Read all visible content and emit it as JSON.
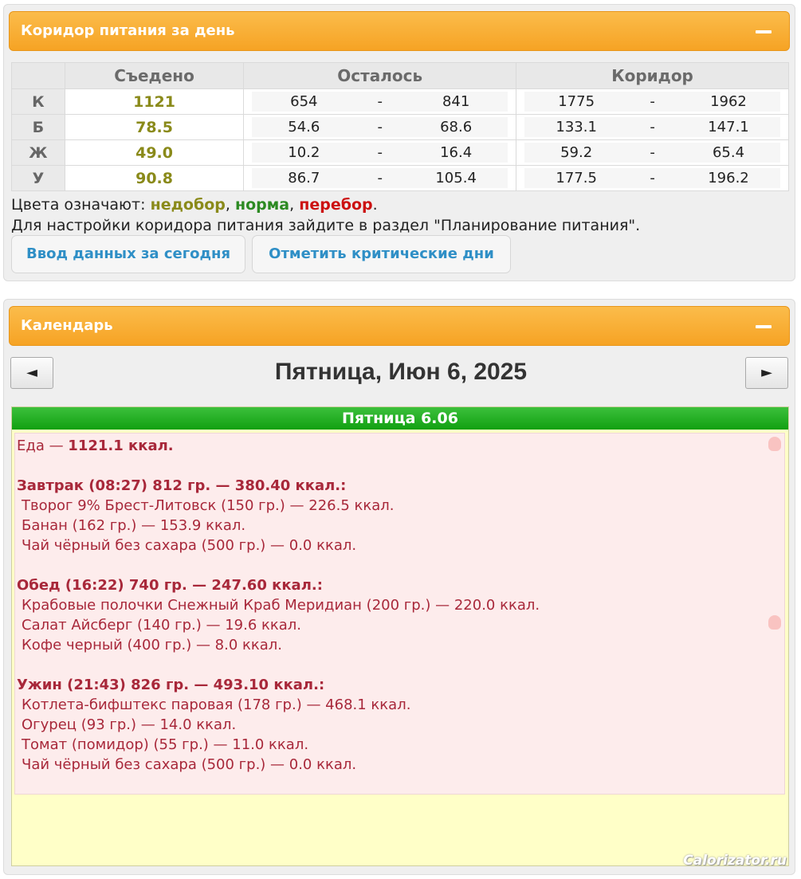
{
  "corridor": {
    "header": "Коридор питания за день",
    "columns": {
      "eaten": "Съедено",
      "remaining": "Осталось",
      "corridor": "Коридор"
    },
    "separator": "-",
    "rows": [
      {
        "label": "К",
        "eaten": "1121",
        "rem_lo": "654",
        "rem_hi": "841",
        "cor_lo": "1775",
        "cor_hi": "1962"
      },
      {
        "label": "Б",
        "eaten": "78.5",
        "rem_lo": "54.6",
        "rem_hi": "68.6",
        "cor_lo": "133.1",
        "cor_hi": "147.1"
      },
      {
        "label": "Ж",
        "eaten": "49.0",
        "rem_lo": "10.2",
        "rem_hi": "16.4",
        "cor_lo": "59.2",
        "cor_hi": "65.4"
      },
      {
        "label": "У",
        "eaten": "90.8",
        "rem_lo": "86.7",
        "rem_hi": "105.4",
        "cor_lo": "177.5",
        "cor_hi": "196.2"
      }
    ],
    "legend": {
      "prefix": "Цвета означают: ",
      "under": "недобор",
      "comma": ", ",
      "norm": "норма",
      "over": "перебор",
      "end": "."
    },
    "help": "Для настройки коридора питания зайдите в раздел \"Планирование питания\".",
    "btn_input": "Ввод данных за сегодня",
    "btn_critical": "Отметить критические дни"
  },
  "calendar": {
    "header": "Календарь",
    "prev": "◄",
    "next": "►",
    "date": "Пятница, Июн 6, 2025",
    "day_bar": "Пятница 6.06",
    "food_total_label": "Еда — ",
    "food_total_value": "1121.1 ккал.",
    "meals": [
      {
        "title": "Завтрак (08:27) 812 гр. — 380.40 ккал.:",
        "items": [
          "Творог 9% Брест-Литовск (150 гр.) — 226.5 ккал.",
          "Банан (162 гр.) — 153.9 ккал.",
          "Чай чёрный без сахара (500 гр.) — 0.0 ккал."
        ]
      },
      {
        "title": "Обед (16:22) 740 гр. — 247.60 ккал.:",
        "items": [
          "Крабовые полочки Снежный Краб Меридиан (200 гр.) — 220.0 ккал.",
          "Салат Айсберг (140 гр.) — 19.6 ккал.",
          "Кофе черный (400 гр.) — 8.0 ккал."
        ]
      },
      {
        "title": "Ужин (21:43) 826 гр. — 493.10 ккал.:",
        "items": [
          "Котлета-бифштекс паровая (178 гр.) — 468.1 ккал.",
          "Огурец (93 гр.) — 14.0 ккал.",
          "Томат (помидор) (55 гр.) — 11.0 ккал.",
          "Чай чёрный без сахара (500 гр.) — 0.0 ккал."
        ]
      }
    ]
  },
  "watermark": "Calorizator.ru",
  "colors": {
    "under": "#8a8a1a",
    "norm": "#2c8a22",
    "over": "#cc1111",
    "header_orange": "#f6a324",
    "day_green": "#11a011",
    "food_text": "#a8283a"
  },
  "icons": {
    "collapse": "minus-icon",
    "prev": "left-arrow-icon",
    "next": "right-arrow-icon",
    "finger": "pointing-finger-icon"
  }
}
